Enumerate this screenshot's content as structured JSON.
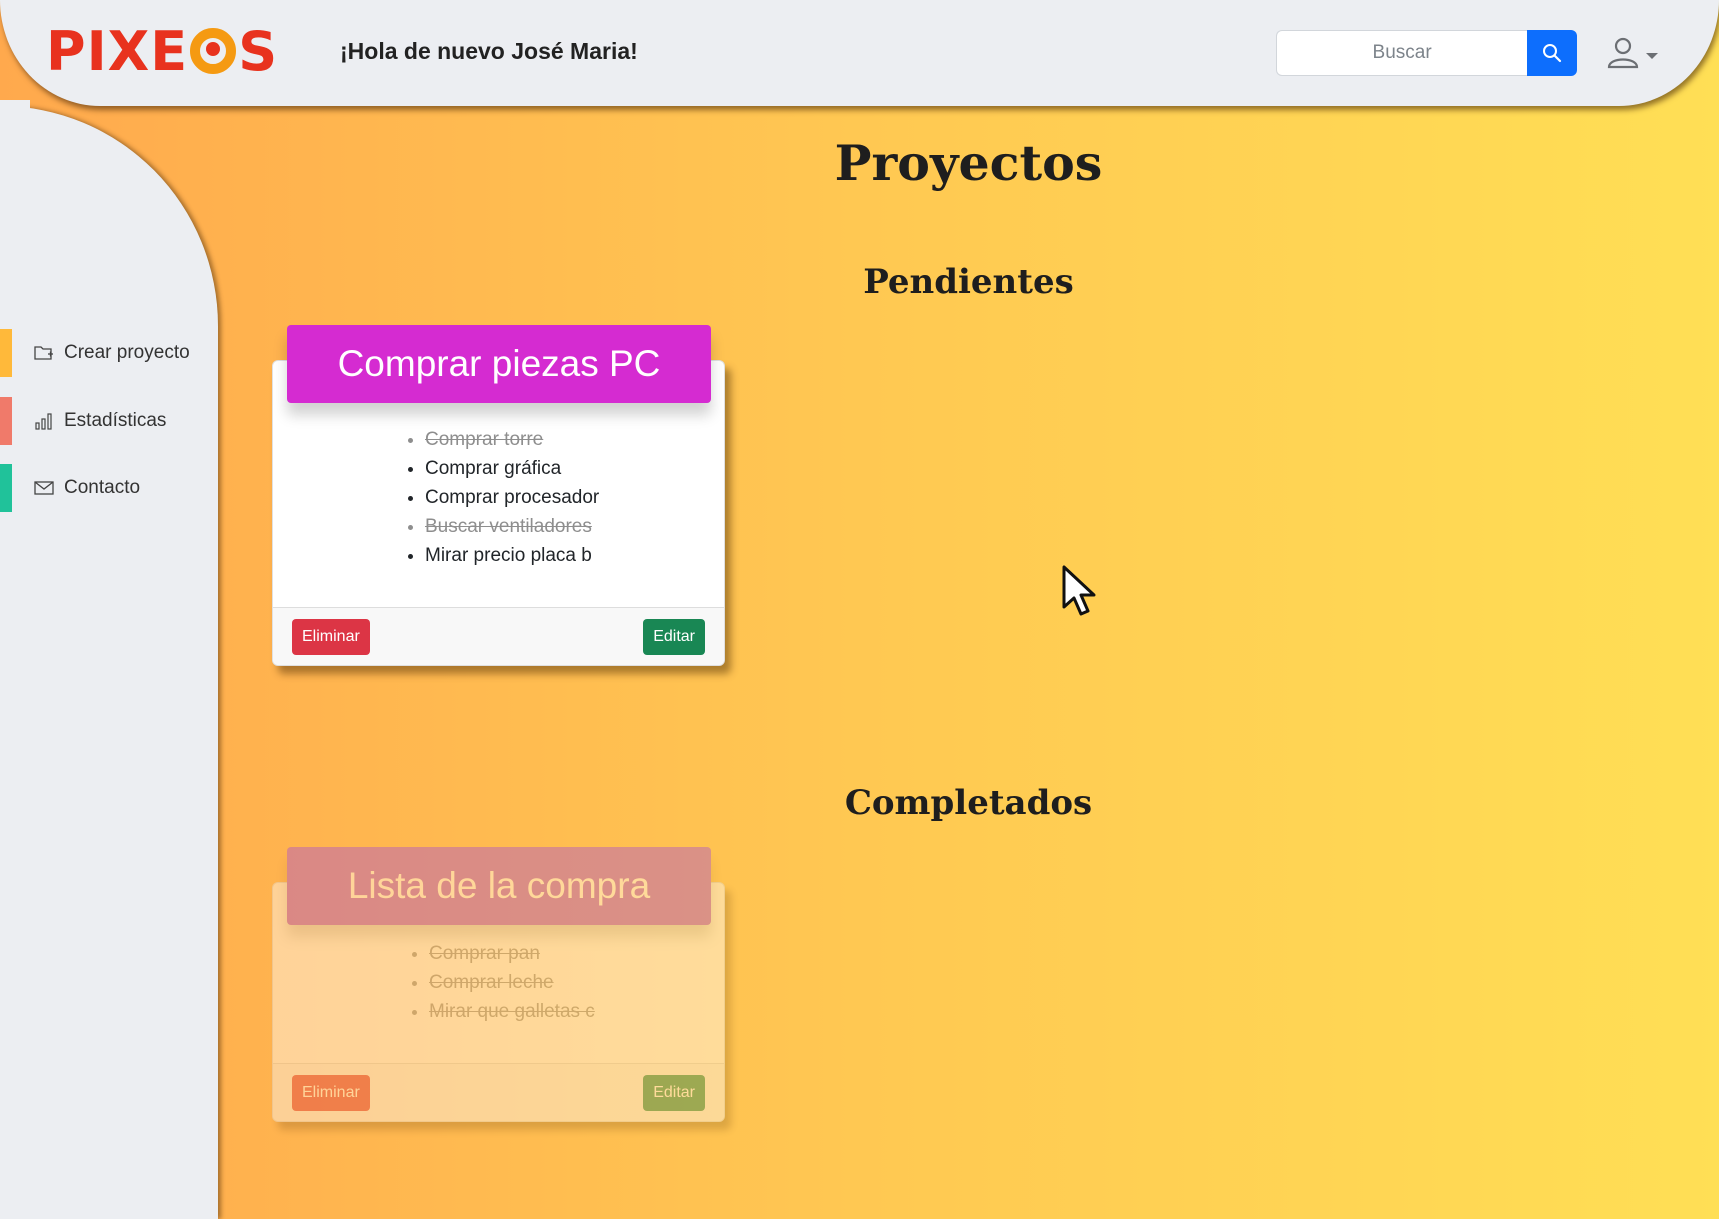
{
  "header": {
    "logo_text_left": "PIXE",
    "logo_text_right": "S",
    "greeting": "¡Hola de nuevo José Maria!",
    "search_placeholder": "Buscar"
  },
  "sidebar": {
    "items": [
      {
        "label": "Crear proyecto",
        "color": "#ffb93a"
      },
      {
        "label": "Estadísticas",
        "color": "#f07a6a"
      },
      {
        "label": "Contacto",
        "color": "#20c29a"
      }
    ]
  },
  "main": {
    "title": "Proyectos",
    "pending_title": "Pendientes",
    "completed_title": "Completados"
  },
  "pending_project": {
    "name": "Comprar piezas PC",
    "header_color": "#d52bd1",
    "tasks": [
      {
        "text": "Comprar torre",
        "done": true
      },
      {
        "text": "Comprar gráfica",
        "done": false
      },
      {
        "text": "Comprar procesador",
        "done": false
      },
      {
        "text": "Buscar ventiladores",
        "done": true
      },
      {
        "text": "Mirar precio placa b",
        "done": false
      }
    ],
    "delete_label": "Eliminar",
    "edit_label": "Editar"
  },
  "completed_project": {
    "name": "Lista de la compra",
    "header_color": "#a84fcf",
    "tasks": [
      {
        "text": "Comprar pan",
        "done": true
      },
      {
        "text": "Comprar leche",
        "done": true
      },
      {
        "text": "Mirar que galletas c",
        "done": true
      }
    ],
    "delete_label": "Eliminar",
    "edit_label": "Editar"
  }
}
